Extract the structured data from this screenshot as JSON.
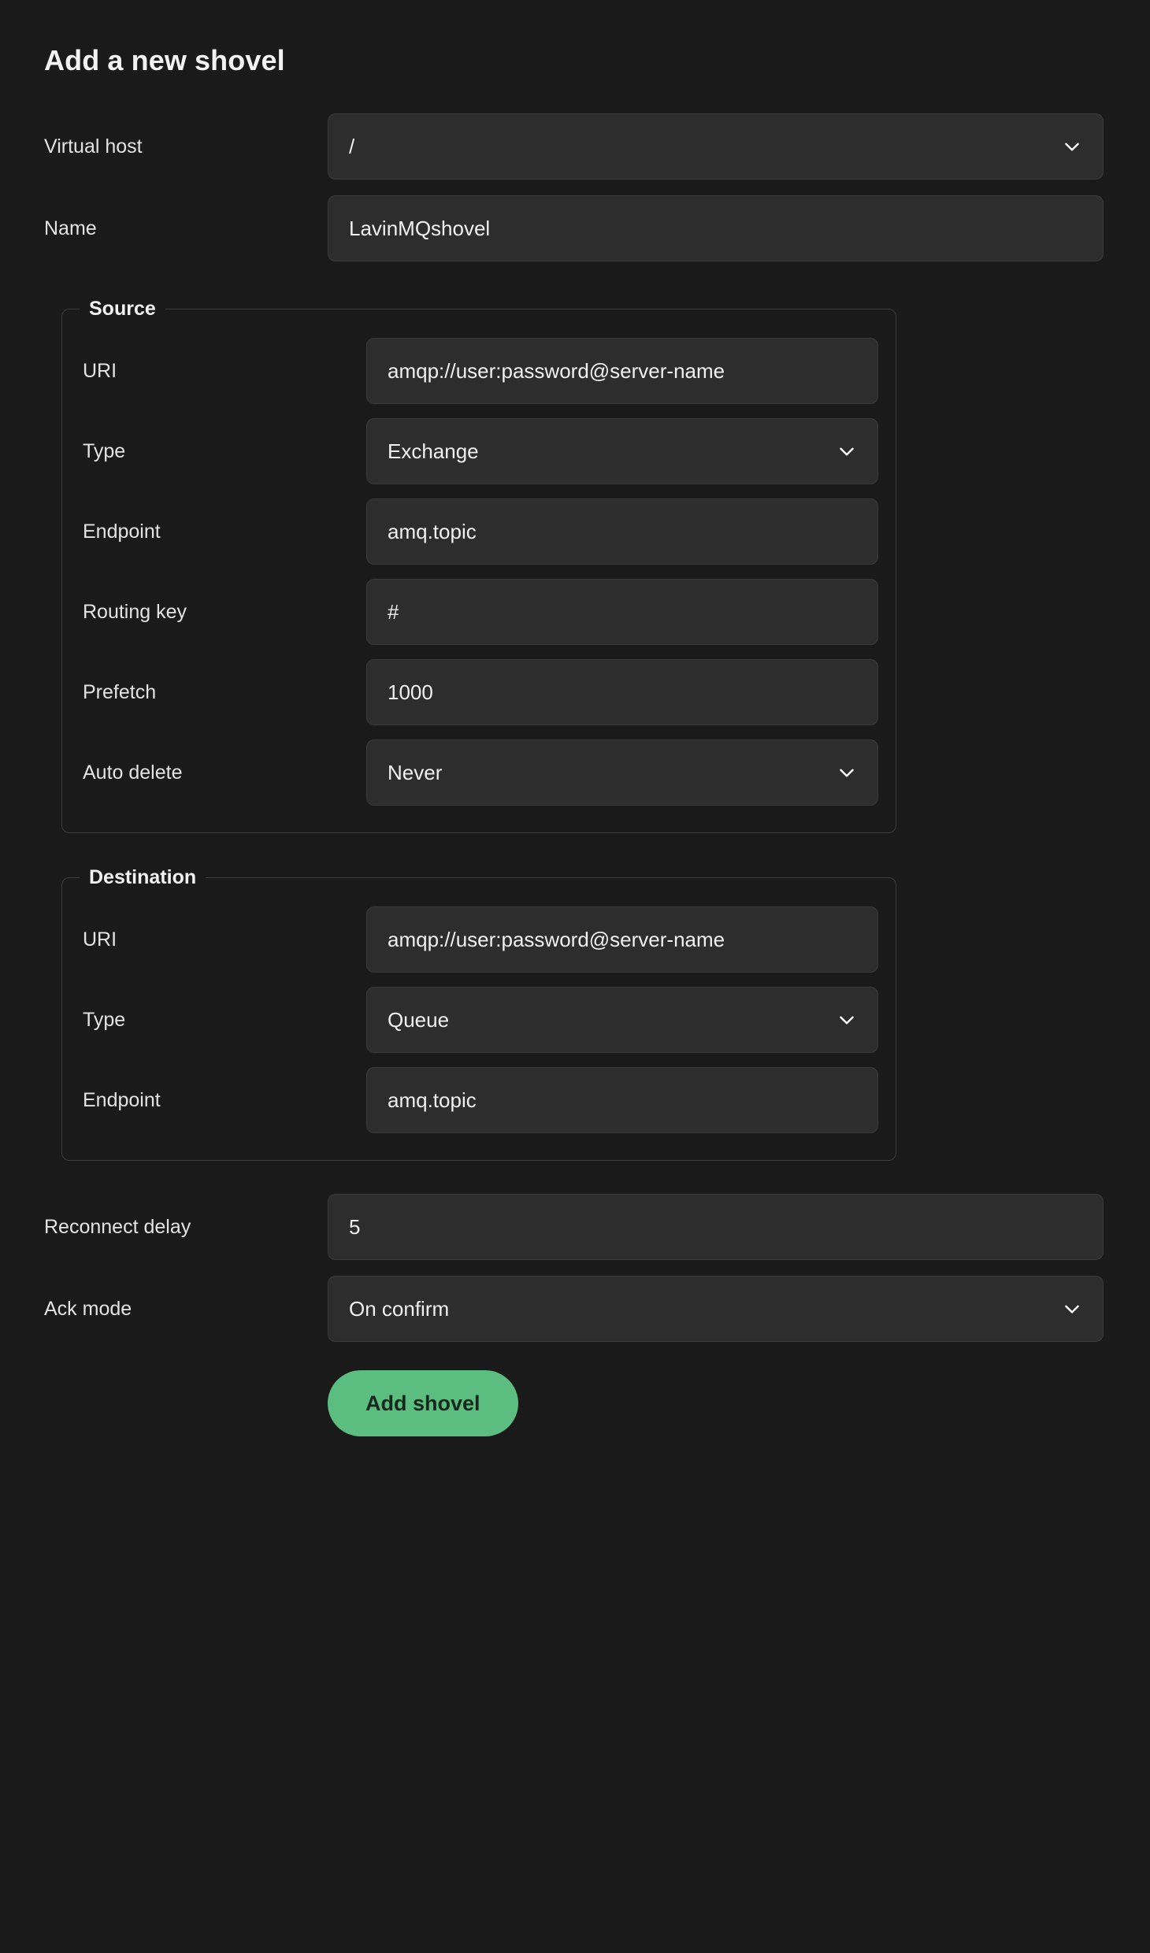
{
  "title": "Add a new shovel",
  "form": {
    "virtual_host": {
      "label": "Virtual host",
      "value": "/",
      "control": "select",
      "icon": "chevron-down-icon"
    },
    "name": {
      "label": "Name",
      "value": "LavinMQshovel",
      "control": "text"
    },
    "source": {
      "legend": "Source",
      "fields": [
        {
          "label": "URI",
          "value": "amqp://user:password@server-name",
          "control": "text",
          "is_placeholder": true
        },
        {
          "label": "Type",
          "value": "Exchange",
          "control": "select",
          "icon": "chevron-down-icon"
        },
        {
          "label": "Endpoint",
          "value": "amq.topic",
          "control": "text"
        },
        {
          "label": "Routing key",
          "value": "#",
          "control": "text"
        },
        {
          "label": "Prefetch",
          "value": "1000",
          "control": "text"
        },
        {
          "label": "Auto delete",
          "value": "Never",
          "control": "select",
          "icon": "chevron-down-icon"
        }
      ]
    },
    "destination": {
      "legend": "Destination",
      "fields": [
        {
          "label": "URI",
          "value": "amqp://user:password@server-name",
          "control": "text",
          "is_placeholder": true
        },
        {
          "label": "Type",
          "value": "Queue",
          "control": "select",
          "icon": "chevron-down-icon"
        },
        {
          "label": "Endpoint",
          "value": "amq.topic",
          "control": "text"
        }
      ]
    },
    "reconnect_delay": {
      "label": "Reconnect delay",
      "value": "5",
      "control": "text"
    },
    "ack_mode": {
      "label": "Ack mode",
      "value": "On confirm",
      "control": "select",
      "icon": "chevron-down-icon"
    },
    "submit": {
      "label": "Add shovel"
    }
  },
  "colors": {
    "page_background": "#1a1a1a",
    "field_background": "#2d2d2d",
    "field_border": "#3a3a3a",
    "text": "#f0f0f0",
    "accent_button": "#5cbd80",
    "accent_button_text": "#16281d"
  }
}
